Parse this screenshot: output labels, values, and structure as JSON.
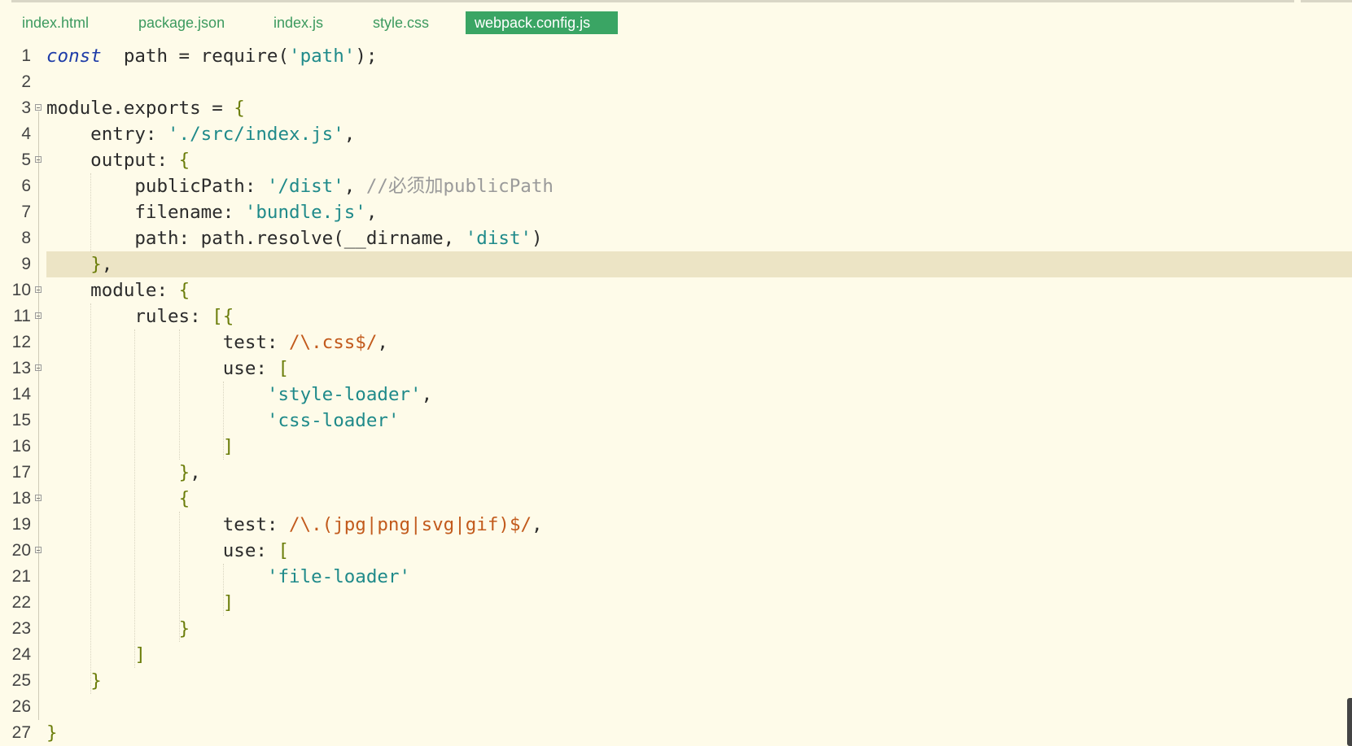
{
  "tabs": [
    {
      "label": "index.html",
      "active": false
    },
    {
      "label": "package.json",
      "active": false
    },
    {
      "label": "index.js",
      "active": false
    },
    {
      "label": "style.css",
      "active": false
    },
    {
      "label": "webpack.config.js",
      "active": true
    }
  ],
  "editor": {
    "file": "webpack.config.js",
    "highlighted_line": 9,
    "lines": [
      {
        "n": "1",
        "tokens": [
          [
            "kw",
            "const"
          ],
          [
            "",
            "  path = require("
          ],
          [
            "str",
            "'path'"
          ],
          [
            "",
            ");"
          ]
        ]
      },
      {
        "n": "2",
        "tokens": []
      },
      {
        "n": "3",
        "tokens": [
          [
            "",
            "module.exports = {"
          ]
        ]
      },
      {
        "n": "4",
        "tokens": [
          [
            "",
            "    entry: "
          ],
          [
            "str",
            "'./src/index.js'"
          ],
          [
            "",
            ","
          ]
        ]
      },
      {
        "n": "5",
        "tokens": [
          [
            "",
            "    output: {"
          ]
        ]
      },
      {
        "n": "6",
        "tokens": [
          [
            "",
            "        publicPath: "
          ],
          [
            "str",
            "'/dist'"
          ],
          [
            "",
            ", "
          ],
          [
            "cm",
            "//必须加publicPath"
          ]
        ]
      },
      {
        "n": "7",
        "tokens": [
          [
            "",
            "        filename: "
          ],
          [
            "str",
            "'bundle.js'"
          ],
          [
            "",
            ","
          ]
        ]
      },
      {
        "n": "8",
        "tokens": [
          [
            "",
            "        path: path.resolve(__dirname, "
          ],
          [
            "str",
            "'dist'"
          ],
          [
            "",
            ")"
          ]
        ]
      },
      {
        "n": "9",
        "tokens": [
          [
            "",
            "    },"
          ]
        ]
      },
      {
        "n": "10",
        "tokens": [
          [
            "",
            "    module: {"
          ]
        ]
      },
      {
        "n": "11",
        "tokens": [
          [
            "",
            "        rules: [{"
          ]
        ]
      },
      {
        "n": "12",
        "tokens": [
          [
            "",
            "                test: "
          ],
          [
            "re",
            "/\\.css$/"
          ],
          [
            "",
            ","
          ]
        ]
      },
      {
        "n": "13",
        "tokens": [
          [
            "",
            "                use: ["
          ]
        ]
      },
      {
        "n": "14",
        "tokens": [
          [
            "",
            "                    "
          ],
          [
            "str",
            "'style-loader'"
          ],
          [
            "",
            ","
          ]
        ]
      },
      {
        "n": "15",
        "tokens": [
          [
            "",
            "                    "
          ],
          [
            "str",
            "'css-loader'"
          ]
        ]
      },
      {
        "n": "16",
        "tokens": [
          [
            "",
            "                ]"
          ]
        ]
      },
      {
        "n": "17",
        "tokens": [
          [
            "",
            "            },"
          ]
        ]
      },
      {
        "n": "18",
        "tokens": [
          [
            "",
            "            {"
          ]
        ]
      },
      {
        "n": "19",
        "tokens": [
          [
            "",
            "                test: "
          ],
          [
            "re",
            "/\\.(jpg|png|svg|gif)$/"
          ],
          [
            "",
            ","
          ]
        ]
      },
      {
        "n": "20",
        "tokens": [
          [
            "",
            "                use: ["
          ]
        ]
      },
      {
        "n": "21",
        "tokens": [
          [
            "",
            "                    "
          ],
          [
            "str",
            "'file-loader'"
          ]
        ]
      },
      {
        "n": "22",
        "tokens": [
          [
            "",
            "                ]"
          ]
        ]
      },
      {
        "n": "23",
        "tokens": [
          [
            "",
            "            }"
          ]
        ]
      },
      {
        "n": "24",
        "tokens": [
          [
            "",
            "        ]"
          ]
        ]
      },
      {
        "n": "25",
        "tokens": [
          [
            "",
            "    }"
          ]
        ]
      },
      {
        "n": "26",
        "tokens": []
      },
      {
        "n": "27",
        "tokens": [
          [
            "",
            "}"
          ]
        ]
      }
    ]
  },
  "colors": {
    "background": "#fefbe9",
    "active_tab": "#3aa564",
    "tab_text": "#3c9a5f",
    "keyword": "#1e3ca8",
    "string": "#1f8a8a",
    "regex": "#c25a1c",
    "comment": "#9a9a9a",
    "line_highlight": "#ece4c5"
  }
}
